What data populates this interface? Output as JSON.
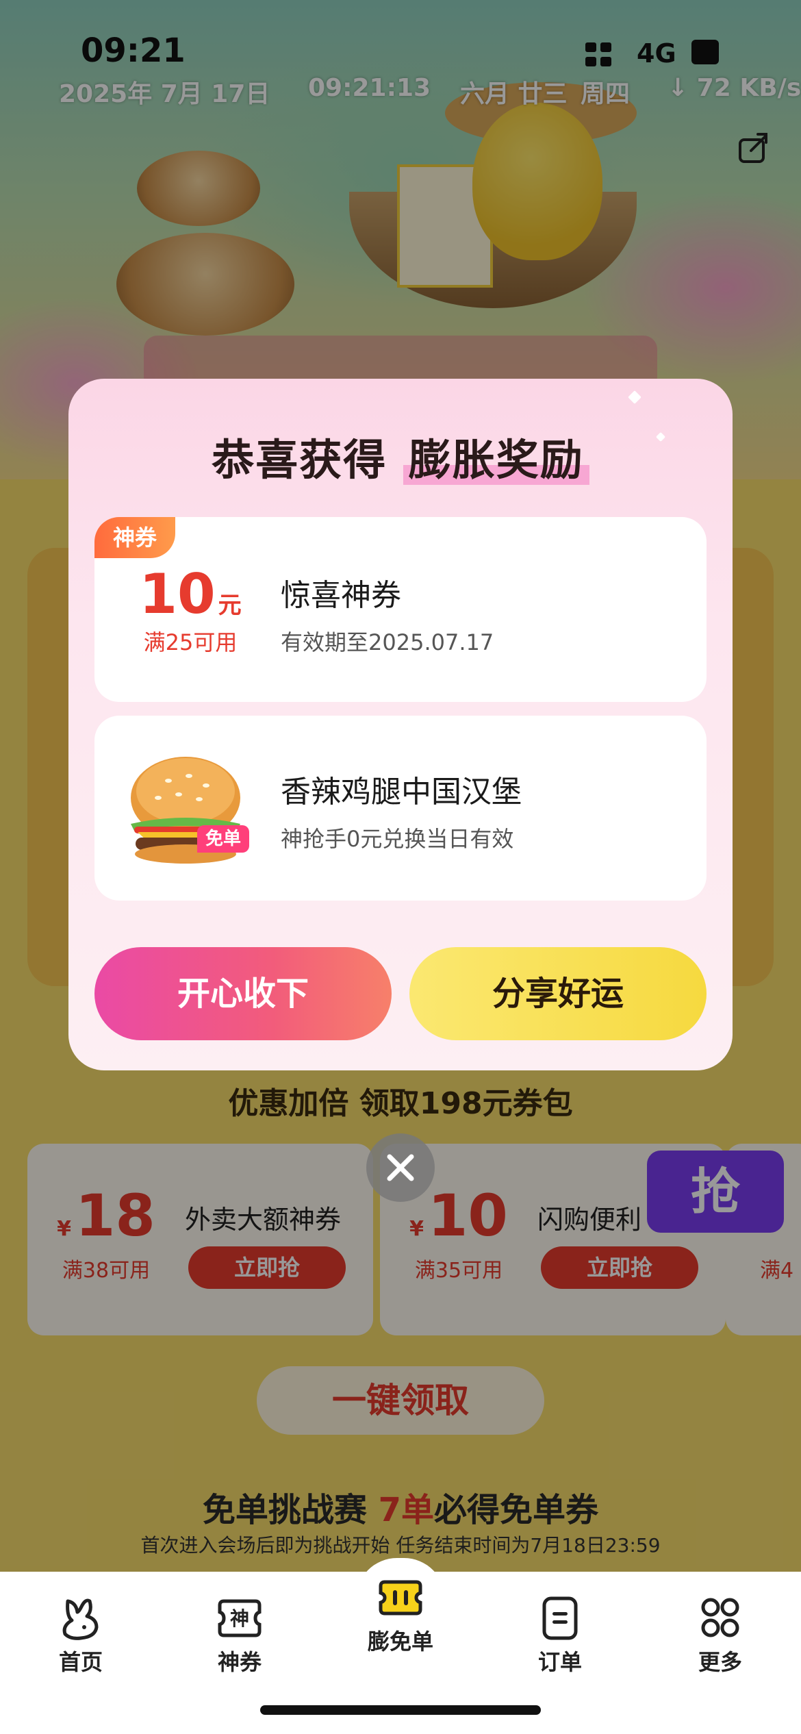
{
  "status_bar": {
    "time": "09:21",
    "network": "4G",
    "date": "2025年 7月 17日",
    "clock": "09:21:13",
    "lunar_date": "六月 廿三",
    "weekday": "周四",
    "net_speed": "↓ 72 KB/s"
  },
  "modal": {
    "title_normal": "恭喜获得",
    "title_emphasis": "膨胀奖励",
    "coupon": {
      "tag": "神券",
      "amount": "10",
      "unit": "元",
      "condition": "满25可用",
      "name": "惊喜神券",
      "validity": "有效期至2025.07.17"
    },
    "burger": {
      "badge": "免单",
      "name": "香辣鸡腿中国汉堡",
      "desc": "神抢手0元兑换当日有效"
    },
    "accept_label": "开心收下",
    "share_label": "分享好运"
  },
  "background": {
    "section_title": "优惠加倍 领取198元券包",
    "coupons": [
      {
        "currency": "¥",
        "amount": "18",
        "condition": "满38可用",
        "name": "外卖大额神券",
        "button": "立即抢"
      },
      {
        "currency": "¥",
        "amount": "10",
        "condition": "满35可用",
        "name": "闪购便利",
        "button": "立即抢"
      }
    ],
    "peek_condition": "满4",
    "grab_badge": "抢",
    "one_click_label": "一键领取",
    "challenge_title_a": "免单挑战赛 ",
    "challenge_title_hl": "7单",
    "challenge_title_b": "必得免单券",
    "challenge_sub": "首次进入会场后即为挑战开始 任务结束时间为7月18日23:59"
  },
  "tabbar": {
    "tabs": [
      {
        "label": "首页",
        "icon": "home-rabbit-icon"
      },
      {
        "label": "神券",
        "icon": "shen-coupon-icon"
      },
      {
        "label": "膨免单",
        "icon": "ticket-icon"
      },
      {
        "label": "订单",
        "icon": "order-icon"
      },
      {
        "label": "更多",
        "icon": "grid-icon"
      }
    ]
  },
  "colors": {
    "accent_red": "#e63b2e",
    "accept_gradient_start": "#ea4aa5",
    "share_yellow": "#f6d93f",
    "page_yellow": "#f7dc6c"
  }
}
